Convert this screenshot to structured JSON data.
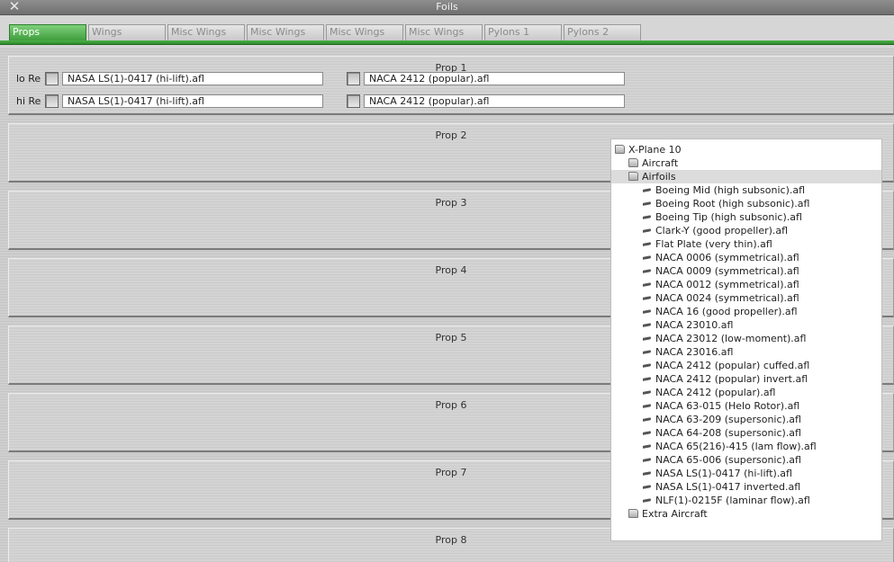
{
  "window": {
    "title": "Foils"
  },
  "tabs": [
    "Props",
    "Wings",
    "Misc Wings",
    "Misc Wings",
    "Misc Wings",
    "Misc Wings",
    "Pylons 1",
    "Pylons 2"
  ],
  "active_tab": "Props",
  "prop1": {
    "title": "Prop 1",
    "lo_re_label": "lo Re",
    "hi_re_label": "hi Re",
    "lo_re_left": "NASA LS(1)-0417 (hi-lift).afl",
    "lo_re_right": "NACA 2412 (popular).afl",
    "hi_re_left": "NASA LS(1)-0417 (hi-lift).afl",
    "hi_re_right": "NACA 2412 (popular).afl"
  },
  "props": [
    "Prop 2",
    "Prop 3",
    "Prop 4",
    "Prop 5",
    "Prop 6",
    "Prop 7",
    "Prop 8"
  ],
  "browser": {
    "root": "X-Plane 10",
    "folder_aircraft": "Aircraft",
    "folder_airfoils": "Airfoils",
    "files": [
      "Boeing Mid (high subsonic).afl",
      "Boeing Root (high subsonic).afl",
      "Boeing Tip (high subsonic).afl",
      "Clark-Y (good propeller).afl",
      "Flat Plate (very thin).afl",
      "NACA 0006 (symmetrical).afl",
      "NACA 0009 (symmetrical).afl",
      "NACA 0012 (symmetrical).afl",
      "NACA 0024 (symmetrical).afl",
      "NACA 16 (good propeller).afl",
      "NACA 23010.afl",
      "NACA 23012 (low-moment).afl",
      "NACA 23016.afl",
      "NACA 2412 (popular) cuffed.afl",
      "NACA 2412 (popular) invert.afl",
      "NACA 2412 (popular).afl",
      "NACA 63-015 (Helo Rotor).afl",
      "NACA 63-209 (supersonic).afl",
      "NACA 64-208 (supersonic).afl",
      "NACA 65(216)-415 (lam flow).afl",
      "NACA 65-006 (supersonic).afl",
      "NASA LS(1)-0417 (hi-lift).afl",
      "NASA LS(1)-0417 inverted.afl",
      "NLF(1)-0215F (laminar flow).afl"
    ],
    "folder_extra": "Extra Aircraft"
  },
  "colors": {
    "tab_active": "#3c9b3a",
    "tab_bar_underline": "#4bb248"
  }
}
